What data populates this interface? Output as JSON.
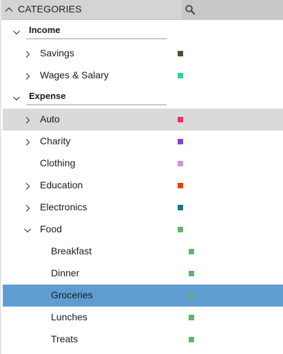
{
  "header": {
    "title": "CATEGORIES",
    "collapse_icon": "chevron-up-icon",
    "search_icon": "search-icon"
  },
  "groups": [
    {
      "label": "Income",
      "expanded": true
    },
    {
      "label": "Expense",
      "expanded": true
    }
  ],
  "income_items": [
    {
      "label": "Savings",
      "color": "#5a4a34",
      "expandable": true
    },
    {
      "label": "Wages & Salary",
      "color": "#2fd39a",
      "expandable": true
    }
  ],
  "expense_items": [
    {
      "label": "Auto",
      "color": "#e8336d",
      "expandable": true,
      "state": "hover"
    },
    {
      "label": "Charity",
      "color": "#8248c8",
      "expandable": true
    },
    {
      "label": "Clothing",
      "color": "#c69ad8",
      "expandable": false
    },
    {
      "label": "Education",
      "color": "#e0460f",
      "expandable": true
    },
    {
      "label": "Electronics",
      "color": "#0b7a88",
      "expandable": true
    },
    {
      "label": "Food",
      "color": "#66b16e",
      "expandable": true,
      "expanded": true
    }
  ],
  "food_items": [
    {
      "label": "Breakfast",
      "color": "#66b16e"
    },
    {
      "label": "Dinner",
      "color": "#66b16e"
    },
    {
      "label": "Groceries",
      "color": "#66b16e",
      "state": "selected"
    },
    {
      "label": "Lunches",
      "color": "#66b16e"
    },
    {
      "label": "Treats",
      "color": "#66b16e"
    }
  ],
  "colors": {
    "header_bg": "#d4d4d4",
    "hover_bg": "#dadada",
    "selected_bg": "#5f9dd0"
  }
}
